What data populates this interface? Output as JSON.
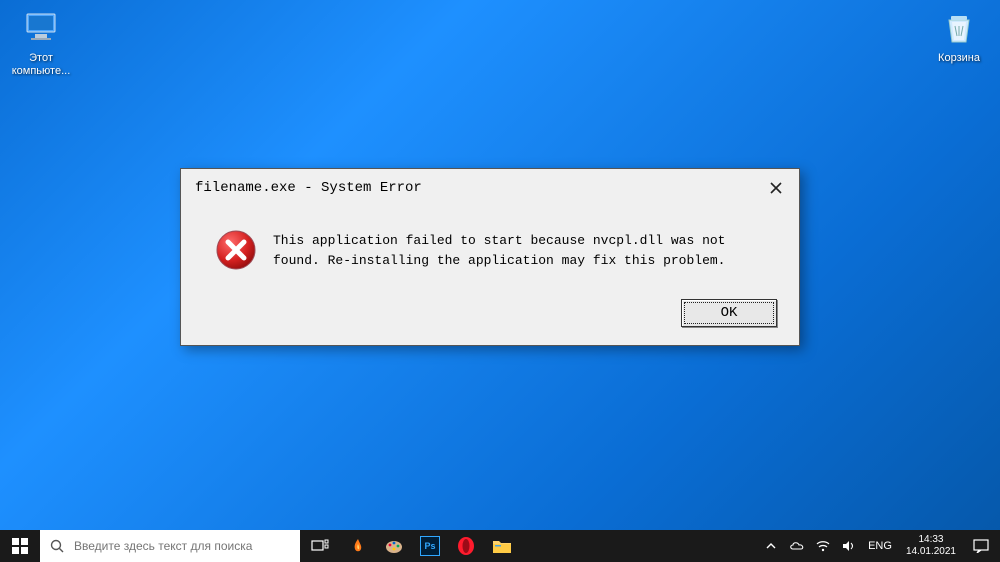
{
  "desktop": {
    "icons": {
      "computer": {
        "label": "Этот\nкомпьюте..."
      },
      "recycle": {
        "label": "Корзина"
      }
    }
  },
  "dialog": {
    "title": "filename.exe - System Error",
    "message": "This application failed to start because nvcpl.dll was not found. Re-installing the application may fix this problem.",
    "ok_label": "OK"
  },
  "taskbar": {
    "search_placeholder": "Введите здесь текст для поиска",
    "language": "ENG",
    "time": "14:33",
    "date": "14.01.2021"
  }
}
